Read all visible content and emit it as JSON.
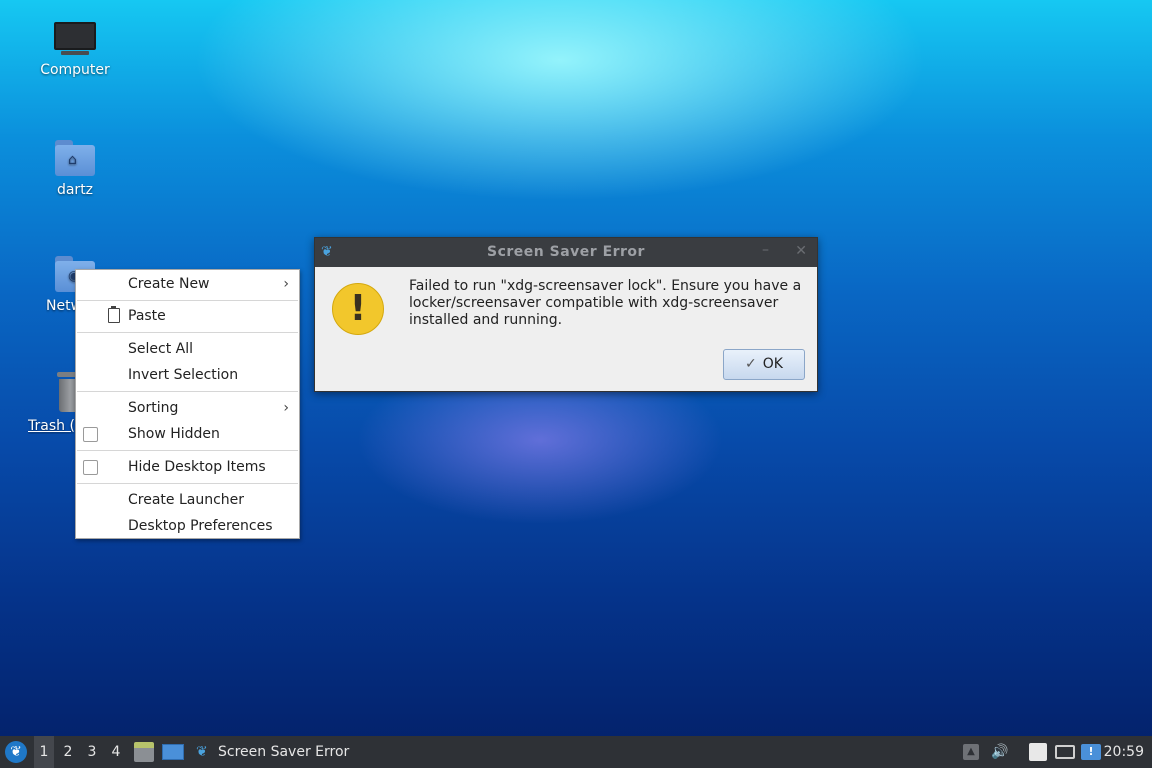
{
  "desktop": {
    "icons": [
      {
        "label": "Computer"
      },
      {
        "label": "dartz"
      },
      {
        "label": "Netw"
      },
      {
        "label": "Trash ("
      }
    ]
  },
  "context_menu": {
    "items": [
      {
        "label": "Create New",
        "submenu": true
      },
      {
        "label": "Paste",
        "icon": "clipboard-icon"
      },
      {
        "label": "Select All"
      },
      {
        "label": "Invert Selection"
      },
      {
        "label": "Sorting",
        "submenu": true
      },
      {
        "label": "Show Hidden",
        "checkbox": true,
        "checked": false
      },
      {
        "label": "Hide Desktop Items",
        "checkbox": true,
        "checked": false
      },
      {
        "label": "Create Launcher"
      },
      {
        "label": "Desktop Preferences"
      }
    ]
  },
  "dialog": {
    "title": "Screen Saver Error",
    "message": "Failed to run  \"xdg-screensaver lock\". Ensure you have a locker/screensaver compatible with xdg-screensaver installed and running.",
    "ok_label": "OK",
    "icon": "warning-icon"
  },
  "taskbar": {
    "workspaces": [
      "1",
      "2",
      "3",
      "4"
    ],
    "active_workspace": "1",
    "task_title": "Screen Saver Error",
    "clock": "20:59"
  },
  "colors": {
    "taskbar_bg": "#2e3136",
    "dialog_title_bg": "#3a3d41",
    "warning_yellow": "#f2c72c"
  }
}
